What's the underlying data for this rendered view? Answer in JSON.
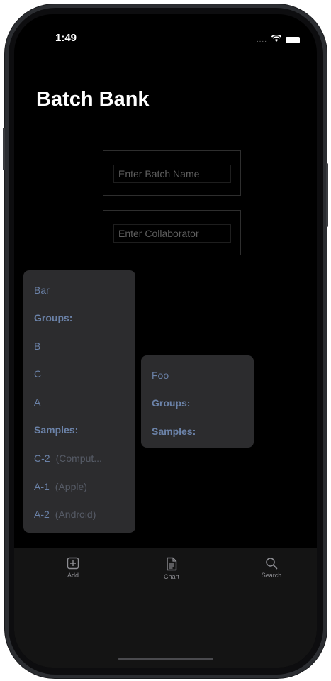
{
  "status_bar": {
    "time": "1:49",
    "signal": "....",
    "wifi_icon": "wifi-icon",
    "battery_icon": "battery-icon"
  },
  "header": {
    "title": "Batch Bank"
  },
  "form": {
    "batch_name_placeholder": "Enter Batch Name",
    "collaborator_placeholder": "Enter Collaborator"
  },
  "batches": [
    {
      "name": "Bar",
      "groups_label": "Groups:",
      "groups": [
        "B",
        "C",
        "A"
      ],
      "samples_label": "Samples:",
      "samples": [
        {
          "id": "C-2",
          "detail": "(Comput..."
        },
        {
          "id": "A-1",
          "detail": "(Apple)"
        },
        {
          "id": "A-2",
          "detail": "(Android)"
        }
      ]
    },
    {
      "name": "Foo",
      "groups_label": "Groups:",
      "groups": [],
      "samples_label": "Samples:",
      "samples": []
    }
  ],
  "tab_bar": {
    "tabs": [
      {
        "label": "Add",
        "icon": "plus-square-icon"
      },
      {
        "label": "Chart",
        "icon": "document-icon"
      },
      {
        "label": "Search",
        "icon": "magnifier-icon"
      }
    ]
  },
  "colors": {
    "background": "#000000",
    "card": "#2c2c2e",
    "card_text": "#6b82a8",
    "card_subtext": "#565b66",
    "tab_tint": "#8e8e93"
  }
}
